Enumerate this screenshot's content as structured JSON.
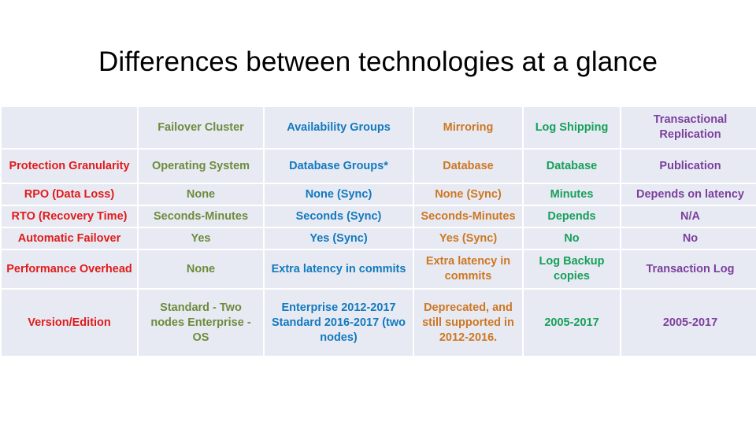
{
  "slide": {
    "title": "Differences between technologies at a glance"
  },
  "colors": {
    "title": "#000000",
    "row_label": "#e01b1b",
    "failover_cluster": "#6d8b3c",
    "availability_groups": "#1279bf",
    "mirroring": "#cd7722",
    "log_shipping": "#16a05a",
    "transactional_replication": "#7b3f9d",
    "cell_background": "#e8eaf3",
    "slide_background": "#ffffff"
  },
  "table": {
    "corner_label": "",
    "columns": [
      {
        "key": "failover_cluster",
        "label": "Failover Cluster"
      },
      {
        "key": "availability_groups",
        "label": "Availability Groups"
      },
      {
        "key": "mirroring",
        "label": "Mirroring"
      },
      {
        "key": "log_shipping",
        "label": "Log Shipping"
      },
      {
        "key": "transactional_replication",
        "label": "Transactional Replication"
      }
    ],
    "rows": [
      {
        "label": "Protection Granularity",
        "cells": [
          "Operating System",
          "Database Groups*",
          "Database",
          "Database",
          "Publication"
        ]
      },
      {
        "label": "RPO (Data Loss)",
        "cells": [
          "None",
          "None (Sync)",
          "None (Sync)",
          "Minutes",
          "Depends on latency"
        ]
      },
      {
        "label": "RTO (Recovery Time)",
        "cells": [
          "Seconds-Minutes",
          "Seconds (Sync)",
          "Seconds-Minutes",
          "Depends",
          "N/A"
        ]
      },
      {
        "label": "Automatic Failover",
        "cells": [
          "Yes",
          "Yes (Sync)",
          "Yes (Sync)",
          "No",
          "No"
        ]
      },
      {
        "label": "Performance Overhead",
        "cells": [
          "None",
          "Extra latency in commits",
          "Extra latency in commits",
          "Log Backup copies",
          "Transaction Log"
        ]
      },
      {
        "label": "Version/Edition",
        "cells": [
          "Standard - Two nodes Enterprise - OS",
          "Enterprise 2012-2017 Standard 2016-2017 (two nodes)",
          "Deprecated, and still supported in 2012-2016.",
          "2005-2017",
          "2005-2017"
        ]
      }
    ]
  }
}
